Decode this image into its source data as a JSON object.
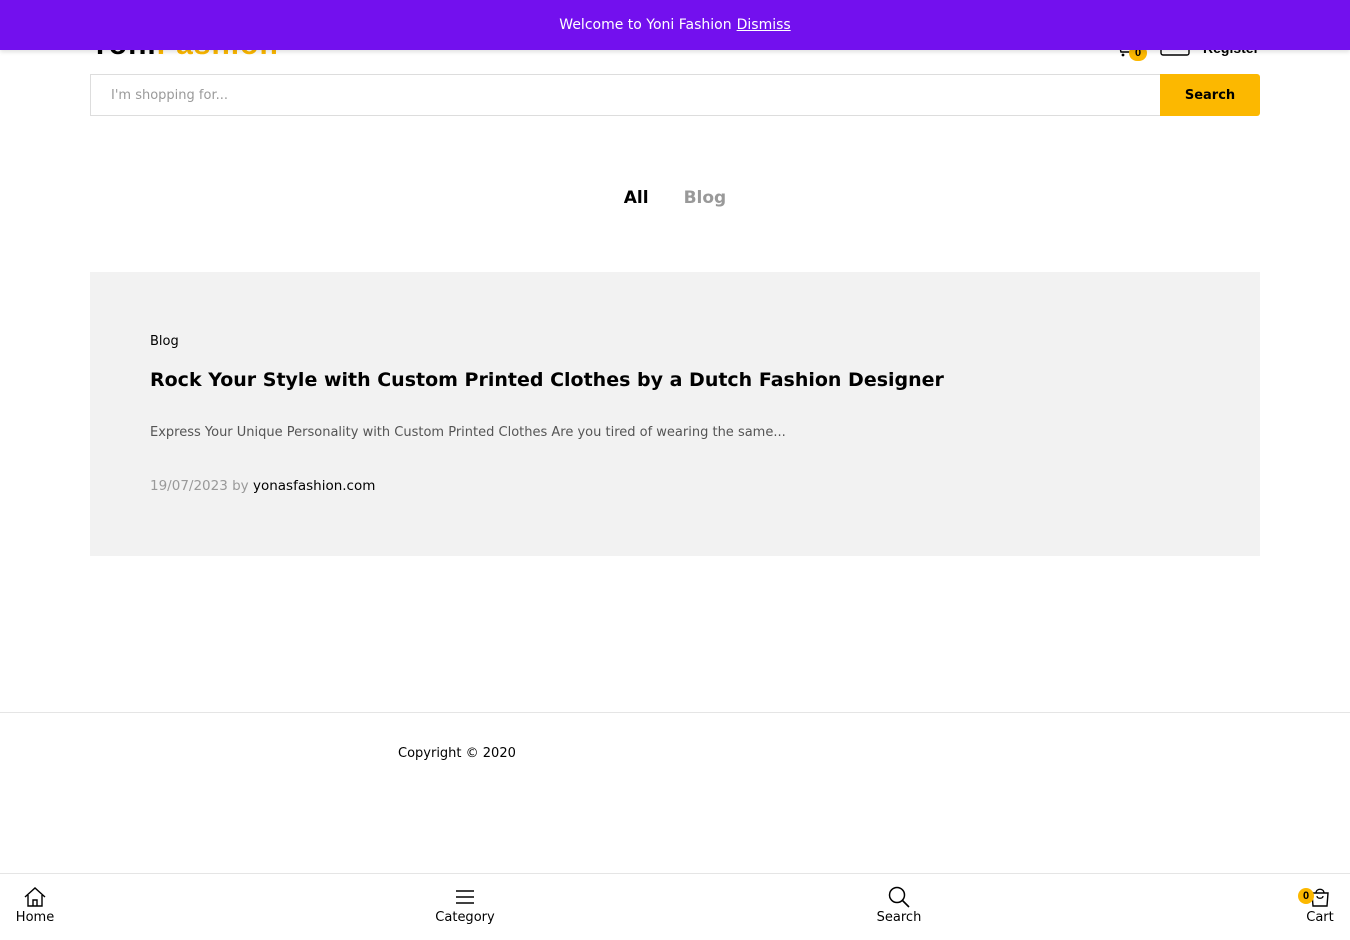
{
  "header": {
    "logo_part1": "Yoni",
    "logo_part2": "Fashion",
    "cart_count": "0",
    "register_label": "Register"
  },
  "notice": {
    "message": "Welcome to Yoni Fashion",
    "dismiss_label": "Dismiss"
  },
  "search": {
    "placeholder": "I'm shopping for...",
    "value": "",
    "button_label": "Search"
  },
  "filters": {
    "tabs": [
      {
        "label": "All",
        "active": true
      },
      {
        "label": "Blog",
        "active": false
      }
    ]
  },
  "posts": [
    {
      "category": "Blog",
      "title": "Rock Your Style with Custom Printed Clothes by a Dutch Fashion Designer",
      "excerpt": "Express Your Unique Personality with Custom Printed Clothes Are you tired of wearing the same...",
      "date": "19/07/2023",
      "by_label": "by",
      "author": "yonasfashion.com"
    }
  ],
  "footer": {
    "copyright": "Copyright © 2020"
  },
  "bottom_nav": {
    "home_label": "Home",
    "category_label": "Category",
    "search_label": "Search",
    "cart_label": "Cart",
    "cart_count": "0"
  },
  "colors": {
    "notice_bg": "#7310ee",
    "accent": "#fcb800",
    "card_bg": "#f2f2f2"
  }
}
